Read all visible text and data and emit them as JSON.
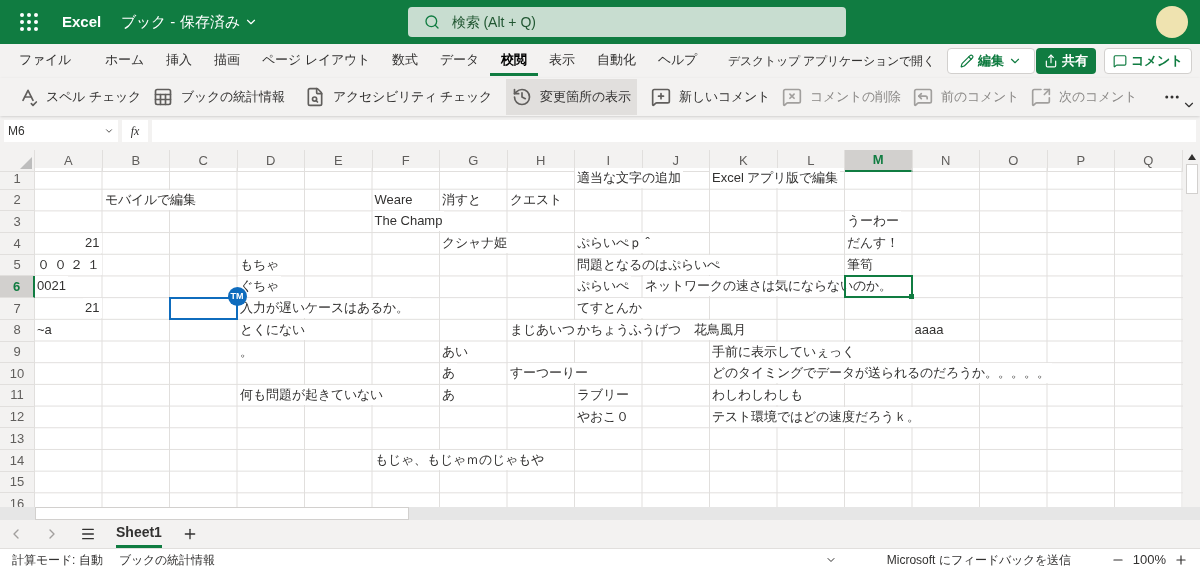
{
  "title_bar": {
    "app_name": "Excel",
    "document_title": "ブック - 保存済み",
    "search_placeholder": "検索 (Alt + Q)"
  },
  "ribbon_tabs": [
    {
      "label": "ファイル",
      "selected": false
    },
    {
      "label": "ホーム",
      "selected": false
    },
    {
      "label": "挿入",
      "selected": false
    },
    {
      "label": "描画",
      "selected": false
    },
    {
      "label": "ページ レイアウト",
      "selected": false
    },
    {
      "label": "数式",
      "selected": false
    },
    {
      "label": "データ",
      "selected": false
    },
    {
      "label": "校閲",
      "selected": true
    },
    {
      "label": "表示",
      "selected": false
    },
    {
      "label": "自動化",
      "selected": false
    },
    {
      "label": "ヘルプ",
      "selected": false
    }
  ],
  "ribbon_actions": {
    "open_desktop": "デスクトップ アプリケーションで開く",
    "edit": "編集",
    "share": "共有",
    "comment": "コメント"
  },
  "toolbar": [
    [
      {
        "label": "スペル チェック",
        "disabled": false,
        "pressed": false
      },
      {
        "label": "ブックの統計情報",
        "disabled": false,
        "pressed": false
      }
    ],
    [
      {
        "label": "アクセシビリティ チェック",
        "disabled": false,
        "pressed": false
      }
    ],
    [
      {
        "label": "変更箇所の表示",
        "disabled": false,
        "pressed": true
      }
    ],
    [
      {
        "label": "新しいコメント",
        "disabled": false,
        "pressed": false
      },
      {
        "label": "コメントの削除",
        "disabled": true,
        "pressed": false
      },
      {
        "label": "前のコメント",
        "disabled": true,
        "pressed": false
      },
      {
        "label": "次のコメント",
        "disabled": true,
        "pressed": false
      }
    ]
  ],
  "formula_bar": {
    "name_box": "M6",
    "fx": "fx"
  },
  "sheet": {
    "columns": [
      {
        "label": "A",
        "selected": false
      },
      {
        "label": "B",
        "selected": false
      },
      {
        "label": "C",
        "selected": false
      },
      {
        "label": "D",
        "selected": false
      },
      {
        "label": "E",
        "selected": false
      },
      {
        "label": "F",
        "selected": false
      },
      {
        "label": "G",
        "selected": false
      },
      {
        "label": "H",
        "selected": false
      },
      {
        "label": "I",
        "selected": false
      },
      {
        "label": "J",
        "selected": false
      },
      {
        "label": "K",
        "selected": false
      },
      {
        "label": "L",
        "selected": false
      },
      {
        "label": "M",
        "selected": true
      },
      {
        "label": "N",
        "selected": false
      },
      {
        "label": "O",
        "selected": false
      },
      {
        "label": "P",
        "selected": false
      },
      {
        "label": "Q",
        "selected": false
      }
    ],
    "rows": [
      {
        "label": "1",
        "selected": false,
        "cells": [
          null,
          null,
          null,
          null,
          null,
          null,
          null,
          null,
          {
            "text": "適当な文字の追加"
          },
          null,
          {
            "text": "Excel アプリ版で編集"
          }
        ]
      },
      {
        "label": "2",
        "selected": false,
        "cells": [
          null,
          {
            "text": "モバイルで編集"
          },
          null,
          null,
          null,
          {
            "text": "Weare"
          },
          {
            "text": "消すと"
          },
          {
            "text": "クエスト"
          }
        ]
      },
      {
        "label": "3",
        "selected": false,
        "cells": [
          null,
          null,
          null,
          null,
          null,
          {
            "text": "The Champ"
          },
          null,
          null,
          null,
          null,
          null,
          null,
          {
            "text": "うーわー"
          }
        ]
      },
      {
        "label": "4",
        "selected": false,
        "cells": [
          {
            "text": "21",
            "right_aligned": true
          },
          null,
          null,
          null,
          null,
          null,
          {
            "text": "クシャナ姫"
          },
          null,
          {
            "text": "ぷらいぺｐ ˆ"
          },
          null,
          null,
          null,
          {
            "text": "だんす！"
          }
        ]
      },
      {
        "label": "5",
        "selected": false,
        "cells": [
          {
            "text": "０ ０ ２ １"
          },
          null,
          null,
          {
            "text": "もちゃ"
          },
          null,
          null,
          null,
          null,
          {
            "text": "問題となるのはぷらいぺ"
          },
          null,
          null,
          null,
          {
            "text": "筆筍"
          }
        ]
      },
      {
        "label": "6",
        "selected": true,
        "cells": [
          {
            "text": "0021"
          },
          null,
          null,
          {
            "text": "ぐちゃ"
          },
          null,
          null,
          null,
          null,
          {
            "text": "ぷらいぺ"
          },
          {
            "text": "ネットワークの速さは気にならないのか。"
          },
          null,
          null,
          {
            "active": true
          }
        ]
      },
      {
        "label": "7",
        "selected": false,
        "cells": [
          {
            "text": "21",
            "right_aligned": true
          },
          null,
          {
            "collaborator": "TM"
          },
          {
            "text": "入力が遅いケースはあるか。"
          },
          null,
          null,
          null,
          null,
          {
            "text": "てすとんか"
          }
        ]
      },
      {
        "label": "8",
        "selected": false,
        "cells": [
          {
            "text": "~a"
          },
          null,
          null,
          {
            "text": "とくにない"
          },
          null,
          null,
          null,
          {
            "text": "まじあいつ"
          },
          {
            "text": "かちょうふうげつ　花鳥風月"
          },
          null,
          null,
          null,
          null,
          {
            "text": "aaaa"
          }
        ]
      },
      {
        "label": "9",
        "selected": false,
        "cells": [
          null,
          null,
          null,
          {
            "text": "。"
          },
          null,
          null,
          {
            "text": "あい"
          },
          null,
          null,
          null,
          {
            "text": "手前に表示していぇっく"
          }
        ]
      },
      {
        "label": "10",
        "selected": false,
        "cells": [
          null,
          null,
          null,
          null,
          null,
          null,
          {
            "text": "あ"
          },
          {
            "text": "すーつーりー"
          },
          null,
          null,
          {
            "text": "どのタイミングでデータが送られるのだろうか。。。。。"
          }
        ]
      },
      {
        "label": "11",
        "selected": false,
        "cells": [
          null,
          null,
          null,
          {
            "text": "何も問題が起きていない"
          },
          null,
          null,
          {
            "text": "あ"
          },
          null,
          {
            "text": "ラブリー"
          },
          null,
          {
            "text": "わしわしわしも"
          }
        ]
      },
      {
        "label": "12",
        "selected": false,
        "cells": [
          null,
          null,
          null,
          null,
          null,
          null,
          null,
          null,
          {
            "text": "やおこ０"
          },
          null,
          {
            "text": "テスト環境ではどの速度だろうｋ。"
          }
        ]
      },
      {
        "label": "13",
        "selected": false,
        "cells": []
      },
      {
        "label": "14",
        "selected": false,
        "cells": [
          null,
          null,
          null,
          null,
          null,
          {
            "text": "もじゃ、もじゃｍのじゃもや"
          }
        ]
      },
      {
        "label": "15",
        "selected": false,
        "cells": []
      },
      {
        "label": "16",
        "selected": false,
        "cells": []
      }
    ]
  },
  "sheet_tabs": [
    {
      "label": "Sheet1",
      "selected": true
    }
  ],
  "status_bar": {
    "calc_mode": "計算モード: 自動",
    "workbook_stats": "ブックの統計情報",
    "feedback": "Microsoft にフィードバックを送信",
    "zoom": "100%"
  }
}
